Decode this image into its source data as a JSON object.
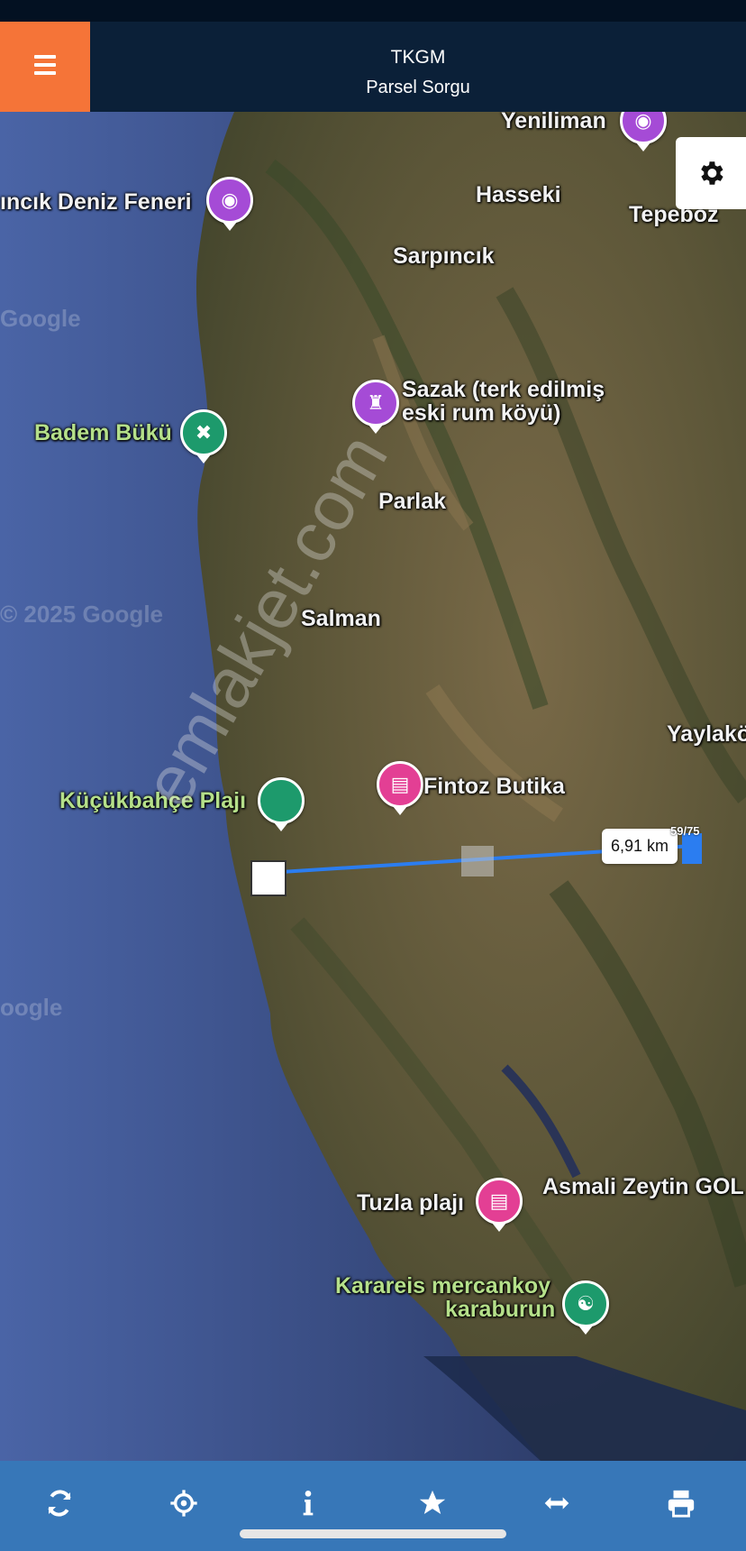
{
  "header": {
    "title": "TKGM",
    "subtitle": "Parsel Sorgu",
    "accent_color": "#f57438",
    "bg_color": "#0b2038"
  },
  "map": {
    "places": [
      {
        "name": "Yeniliman"
      },
      {
        "name": "ıncık Deniz Feneri"
      },
      {
        "name": "Hasseki"
      },
      {
        "name": "Tepeboz"
      },
      {
        "name": "Sarpıncık"
      },
      {
        "name": "Sazak (terk edilmiş"
      },
      {
        "name": "eski rum köyü)"
      },
      {
        "name": "Badem Bükü"
      },
      {
        "name": "Parlak"
      },
      {
        "name": "Salman"
      },
      {
        "name": "Yaylakö"
      },
      {
        "name": "Küçükbahçe Plajı"
      },
      {
        "name": "Fintoz Butika"
      },
      {
        "name": "Tuzla plajı"
      },
      {
        "name": "Asmali Zeytin GOL"
      },
      {
        "name": "Karareis mercankoy"
      },
      {
        "name": "karaburun"
      }
    ],
    "watermarks": [
      "Google",
      "© 2025 Google",
      "oogle",
      "emlakjet.com"
    ],
    "measurement": {
      "distance": "6,91 km",
      "parcel_number": "59/75"
    }
  },
  "toolbar": {
    "buttons": [
      {
        "icon": "refresh-icon"
      },
      {
        "icon": "crosshair-icon"
      },
      {
        "icon": "info-icon"
      },
      {
        "icon": "star-icon"
      },
      {
        "icon": "measure-icon"
      },
      {
        "icon": "print-icon"
      }
    ],
    "bg_color": "#3777b8"
  }
}
